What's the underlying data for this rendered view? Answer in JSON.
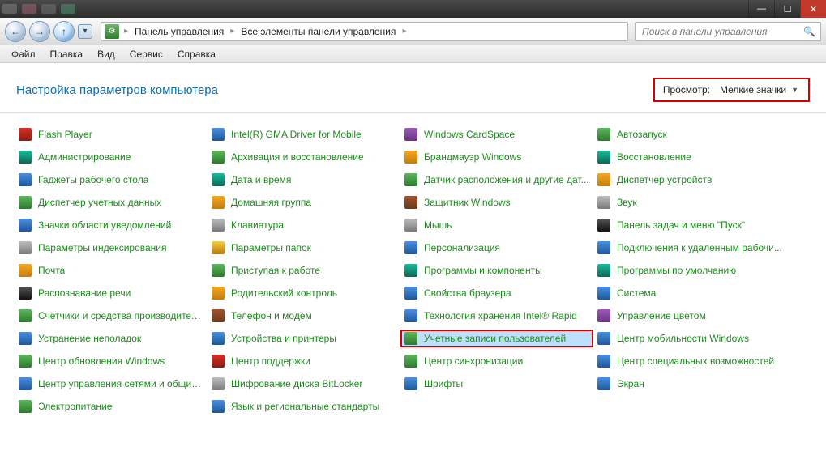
{
  "titlebar": {
    "minimize": "—",
    "maximize": "☐",
    "close": "✕"
  },
  "nav": {
    "back": "←",
    "forward": "→",
    "up": "↑",
    "dropdown": "▾",
    "crumb_icon": "⚙",
    "crumb1": "Панель управления",
    "crumb2": "Все элементы панели управления",
    "search_placeholder": "Поиск в панели управления"
  },
  "menu": {
    "items": [
      "Файл",
      "Правка",
      "Вид",
      "Сервис",
      "Справка"
    ]
  },
  "header": {
    "title": "Настройка параметров компьютера",
    "view_label": "Просмотр:",
    "view_value": "Мелкие значки"
  },
  "cp_items": [
    {
      "col": 0,
      "label": "Flash Player",
      "icon": "ic-red"
    },
    {
      "col": 0,
      "label": "Администрирование",
      "icon": "ic-teal"
    },
    {
      "col": 0,
      "label": "Гаджеты рабочего стола",
      "icon": "ic-blue"
    },
    {
      "col": 0,
      "label": "Диспетчер учетных данных",
      "icon": "ic-green"
    },
    {
      "col": 0,
      "label": "Значки области уведомлений",
      "icon": "ic-blue"
    },
    {
      "col": 0,
      "label": "Параметры индексирования",
      "icon": "ic-gray"
    },
    {
      "col": 0,
      "label": "Почта",
      "icon": "ic-orange"
    },
    {
      "col": 0,
      "label": "Распознавание речи",
      "icon": "ic-black"
    },
    {
      "col": 0,
      "label": "Счетчики и средства производитель...",
      "icon": "ic-green"
    },
    {
      "col": 0,
      "label": "Устранение неполадок",
      "icon": "ic-blue"
    },
    {
      "col": 0,
      "label": "Центр обновления Windows",
      "icon": "ic-green"
    },
    {
      "col": 0,
      "label": "Центр управления сетями и общим ...",
      "icon": "ic-blue"
    },
    {
      "col": 0,
      "label": "Электропитание",
      "icon": "ic-green"
    },
    {
      "col": 1,
      "label": "Intel(R) GMA Driver for Mobile",
      "icon": "ic-blue"
    },
    {
      "col": 1,
      "label": "Архивация и восстановление",
      "icon": "ic-green"
    },
    {
      "col": 1,
      "label": "Дата и время",
      "icon": "ic-teal"
    },
    {
      "col": 1,
      "label": "Домашняя группа",
      "icon": "ic-orange"
    },
    {
      "col": 1,
      "label": "Клавиатура",
      "icon": "ic-gray"
    },
    {
      "col": 1,
      "label": "Параметры папок",
      "icon": "ic-yellow"
    },
    {
      "col": 1,
      "label": "Приступая к работе",
      "icon": "ic-green"
    },
    {
      "col": 1,
      "label": "Родительский контроль",
      "icon": "ic-orange"
    },
    {
      "col": 1,
      "label": "Телефон и модем",
      "icon": "ic-brown"
    },
    {
      "col": 1,
      "label": "Устройства и принтеры",
      "icon": "ic-blue"
    },
    {
      "col": 1,
      "label": "Центр поддержки",
      "icon": "ic-red"
    },
    {
      "col": 1,
      "label": "Шифрование диска BitLocker",
      "icon": "ic-gray"
    },
    {
      "col": 1,
      "label": "Язык и региональные стандарты",
      "icon": "ic-blue"
    },
    {
      "col": 2,
      "label": "Windows CardSpace",
      "icon": "ic-purple"
    },
    {
      "col": 2,
      "label": "Брандмауэр Windows",
      "icon": "ic-orange"
    },
    {
      "col": 2,
      "label": "Датчик расположения и другие дат...",
      "icon": "ic-green"
    },
    {
      "col": 2,
      "label": "Защитник Windows",
      "icon": "ic-brown"
    },
    {
      "col": 2,
      "label": "Мышь",
      "icon": "ic-gray"
    },
    {
      "col": 2,
      "label": "Персонализация",
      "icon": "ic-blue"
    },
    {
      "col": 2,
      "label": "Программы и компоненты",
      "icon": "ic-teal"
    },
    {
      "col": 2,
      "label": "Свойства браузера",
      "icon": "ic-blue"
    },
    {
      "col": 2,
      "label": "Технология хранения Intel® Rapid",
      "icon": "ic-blue"
    },
    {
      "col": 2,
      "label": "Учетные записи пользователей",
      "icon": "ic-green",
      "highlight": true
    },
    {
      "col": 2,
      "label": "Центр синхронизации",
      "icon": "ic-green"
    },
    {
      "col": 2,
      "label": "Шрифты",
      "icon": "ic-blue"
    },
    {
      "col": 3,
      "label": "Автозапуск",
      "icon": "ic-green"
    },
    {
      "col": 3,
      "label": "Восстановление",
      "icon": "ic-teal"
    },
    {
      "col": 3,
      "label": "Диспетчер устройств",
      "icon": "ic-orange"
    },
    {
      "col": 3,
      "label": "Звук",
      "icon": "ic-gray"
    },
    {
      "col": 3,
      "label": "Панель задач и меню \"Пуск\"",
      "icon": "ic-black"
    },
    {
      "col": 3,
      "label": "Подключения к удаленным рабочи...",
      "icon": "ic-blue"
    },
    {
      "col": 3,
      "label": "Программы по умолчанию",
      "icon": "ic-teal"
    },
    {
      "col": 3,
      "label": "Система",
      "icon": "ic-blue"
    },
    {
      "col": 3,
      "label": "Управление цветом",
      "icon": "ic-purple"
    },
    {
      "col": 3,
      "label": "Центр мобильности Windows",
      "icon": "ic-blue"
    },
    {
      "col": 3,
      "label": "Центр специальных возможностей",
      "icon": "ic-blue"
    },
    {
      "col": 3,
      "label": "Экран",
      "icon": "ic-blue"
    }
  ]
}
